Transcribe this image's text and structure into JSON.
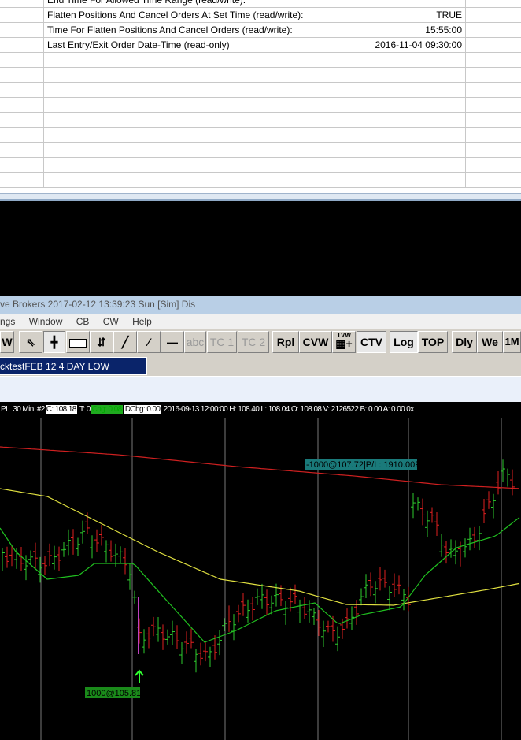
{
  "grid": {
    "rows": [
      {
        "label": "End Time For Allowed Time Range (read/write):",
        "value": ""
      },
      {
        "label": "Flatten Positions And Cancel Orders At Set Time (read/write):",
        "value": "TRUE"
      },
      {
        "label": "Time For Flatten Positions And Cancel Orders (read/write):",
        "value": "15:55:00"
      },
      {
        "label": "Last Entry/Exit Order Date-Time (read-only)",
        "value": "2016-11-04  09:30:00"
      }
    ]
  },
  "window": {
    "title": "ve Brokers 2017-02-12  13:39:23 Sun [Sim]  Dis"
  },
  "menu": [
    "ngs",
    "Window",
    "CB",
    "CW",
    "Help"
  ],
  "toolbar": {
    "w": "W",
    "abc": "abc",
    "tc1": "TC 1",
    "tc2": "TC 2",
    "rpl": "Rpl",
    "cvw": "CVW",
    "tvw": "TVW",
    "ctv": "CTV",
    "log": "Log",
    "top": "TOP",
    "dly": "Dly",
    "we": "We",
    "m1": "1M"
  },
  "tab": {
    "label": "cktestFEB 12 4 DAY LOW REVERSAL"
  },
  "info": {
    "symbol": "PL",
    "interval": "30 Min",
    "num": "#2",
    "close": "C: 108.18",
    "t": "T: 0",
    "chg": "Chg: 0.08",
    "dchg": "DChg: 0.00",
    "rest": "2016-09-13 12:00:00 H: 108.40 L: 108.04 O: 108.08 V: 2126522 B: 0.00 A: 0.00 0x"
  },
  "chart": {
    "sell_label": "-1000@107.72|P/L: 1910.00P",
    "buy_label": "1000@105.81",
    "colors": {
      "up": "#2ecc2e",
      "down": "#e02020",
      "ma_slow": "#d02020",
      "ma_mid": "#e0e040",
      "ma_fast": "#20c020",
      "label_sell": "#1a7a7a",
      "label_buy": "#1a8a1a"
    }
  }
}
